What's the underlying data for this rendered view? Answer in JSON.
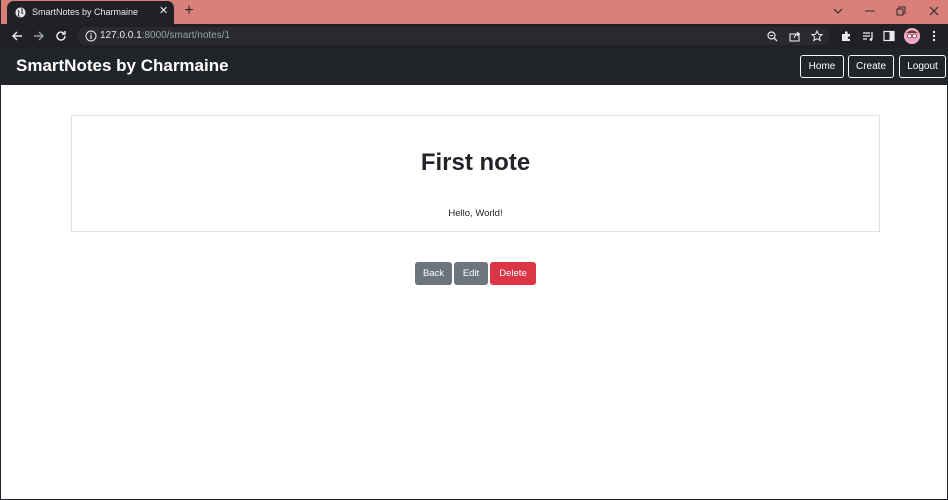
{
  "browser": {
    "tab": {
      "title": "SmartNotes by Charmaine",
      "close_glyph": "✕"
    },
    "new_tab_glyph": "+",
    "address": {
      "host": "127.0.0.1",
      "rest": ":8000/smart/notes/1"
    },
    "icons": [
      "back-icon",
      "forward-icon",
      "reload-icon",
      "info-icon",
      "zoom-icon",
      "share-icon",
      "star-icon",
      "extensions-icon",
      "reading-list-icon",
      "side-panel-icon",
      "avatar-icon",
      "menu-icon",
      "chevron-down-icon",
      "minimize-icon",
      "restore-icon",
      "close-icon"
    ],
    "colors": {
      "tabstrip": "#d9807b",
      "toolbar": "#202124"
    }
  },
  "navbar": {
    "brand": "SmartNotes by Charmaine",
    "links": [
      {
        "label": "Home"
      },
      {
        "label": "Create"
      },
      {
        "label": "Logout"
      }
    ],
    "color": "#212529"
  },
  "note": {
    "title": "First note",
    "body": "Hello, World!"
  },
  "actions": {
    "back_label": "Back",
    "edit_label": "Edit",
    "delete_label": "Delete",
    "colors": {
      "secondary": "#6c757d",
      "danger": "#dc3545"
    }
  }
}
